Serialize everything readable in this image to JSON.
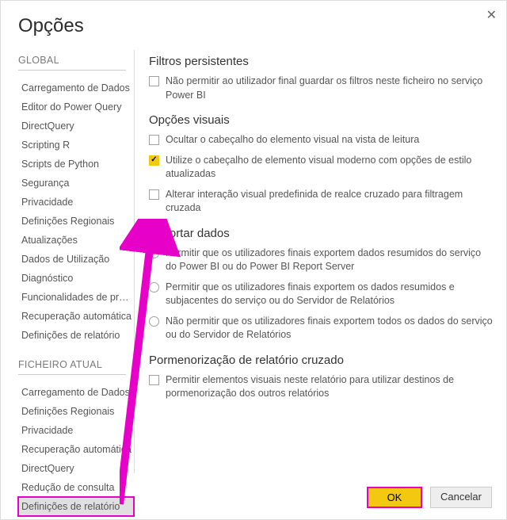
{
  "window": {
    "title": "Opções"
  },
  "sidebar": {
    "global_label": "GLOBAL",
    "global_items": [
      "Carregamento de Dados",
      "Editor do Power Query",
      "DirectQuery",
      "Scripting R",
      "Scripts de Python",
      "Segurança",
      "Privacidade",
      "Definições Regionais",
      "Atualizações",
      "Dados de Utilização",
      "Diagnóstico",
      "Funcionalidades de pr…",
      "Recuperação automática",
      "Definições de relatório"
    ],
    "file_label": "FICHEIRO ATUAL",
    "file_items": [
      "Carregamento de Dados",
      "Definições Regionais",
      "Privacidade",
      "Recuperação automática",
      "DirectQuery",
      "Redução de consulta",
      "Definições de relatório"
    ]
  },
  "content": {
    "persistent_filters": {
      "heading": "Filtros persistentes",
      "opt1": "Não permitir ao utilizador final guardar os filtros neste ficheiro no serviço Power BI"
    },
    "visual_options": {
      "heading": "Opções visuais",
      "opt1": "Ocultar o cabeçalho do elemento visual na vista de leitura",
      "opt2": "Utilize o cabeçalho de elemento visual moderno com opções de estilo atualizadas",
      "opt3": "Alterar interação visual predefinida de realce cruzado para filtragem cruzada"
    },
    "export_data": {
      "heading": "Exportar dados",
      "r1": "Permitir que os utilizadores finais exportem dados resumidos do serviço do Power BI ou do Power BI Report Server",
      "r2": "Permitir que os utilizadores finais exportem os dados resumidos e subjacentes do serviço ou do Servidor de Relatórios",
      "r3": "Não permitir que os utilizadores finais exportem todos os dados do serviço ou do Servidor de Relatórios"
    },
    "cross_drill": {
      "heading": "Pormenorização de relatório cruzado",
      "opt1": "Permitir elementos visuais neste relatório para utilizar destinos de pormenorização dos outros relatórios"
    }
  },
  "footer": {
    "ok": "OK",
    "cancel": "Cancelar"
  }
}
